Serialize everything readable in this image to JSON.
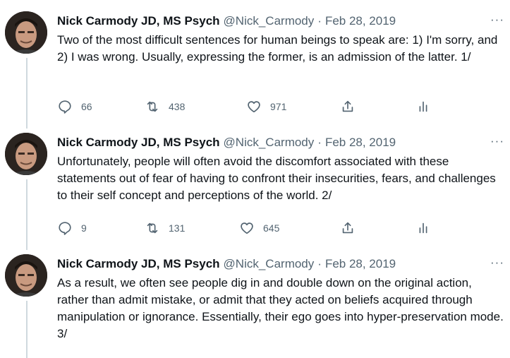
{
  "tweets": [
    {
      "author_name": "Nick Carmody JD, MS Psych",
      "handle": "@Nick_Carmody",
      "separator": "·",
      "date": "Feb 28, 2019",
      "more": "···",
      "text": "Two of the most difficult sentences for human beings to speak are: 1) I'm sorry, and 2) I was wrong.  Usually, expressing the former, is an admission of the latter.  1/",
      "replies": "66",
      "retweets": "438",
      "likes": "971"
    },
    {
      "author_name": "Nick Carmody JD, MS Psych",
      "handle": "@Nick_Carmody",
      "separator": "·",
      "date": "Feb 28, 2019",
      "more": "···",
      "text": "Unfortunately, people will often avoid the discomfort associated with these statements out of fear of having to confront their insecurities, fears, and challenges to their self concept and perceptions of the world.  2/",
      "replies": "9",
      "retweets": "131",
      "likes": "645"
    },
    {
      "author_name": "Nick Carmody JD, MS Psych",
      "handle": "@Nick_Carmody",
      "separator": "·",
      "date": "Feb 28, 2019",
      "more": "···",
      "text": "As a result, we often see people dig in and double down on the original action, rather than admit mistake, or admit that they acted on beliefs acquired through manipulation or ignorance.  Essentially, their ego goes into hyper-preservation mode. 3/"
    }
  ],
  "icons": {
    "reply": "reply-icon",
    "retweet": "retweet-icon",
    "like": "heart-icon",
    "share": "share-icon",
    "analytics": "analytics-icon"
  }
}
